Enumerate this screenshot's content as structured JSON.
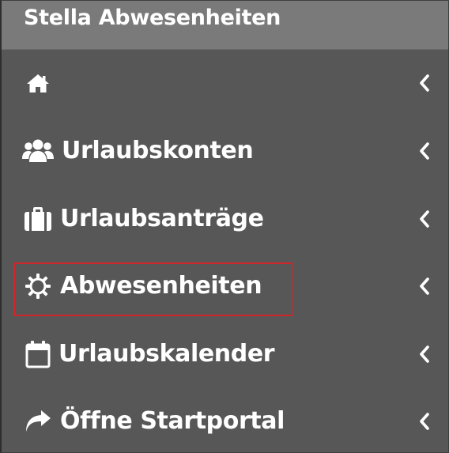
{
  "header": {
    "title": "Stella Abwesenheiten"
  },
  "menu": {
    "items": [
      {
        "label": "",
        "icon": "home-icon"
      },
      {
        "label": "Urlaubskonten",
        "icon": "users-icon"
      },
      {
        "label": "Urlaubsanträge",
        "icon": "suitcase-icon"
      },
      {
        "label": "Abwesenheiten",
        "icon": "gear-icon",
        "highlighted": true
      },
      {
        "label": "Urlaubskalender",
        "icon": "calendar-icon"
      },
      {
        "label": "Öffne Startportal",
        "icon": "share-arrow-icon"
      }
    ]
  },
  "colors": {
    "sidebar_bg": "#575757",
    "header_bg": "#7a7a7a",
    "text": "#ffffff",
    "highlight_border": "#d0262a"
  }
}
